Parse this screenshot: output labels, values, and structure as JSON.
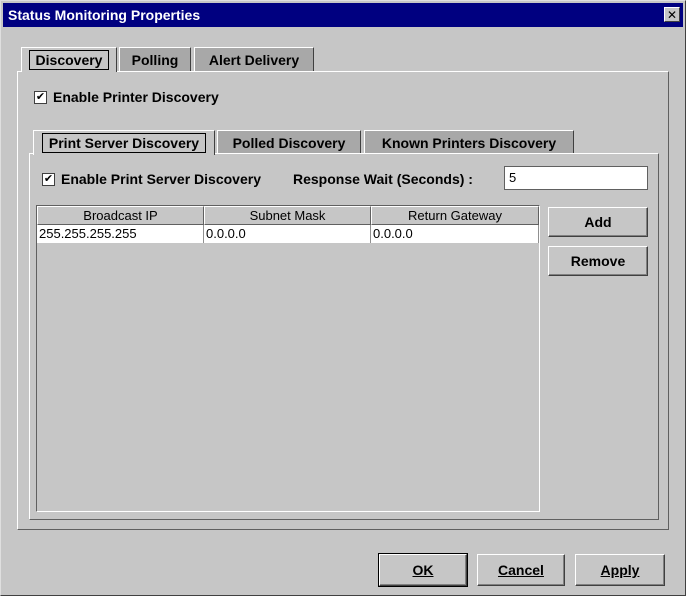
{
  "window": {
    "title": "Status Monitoring Properties",
    "close_label": "✕"
  },
  "outer_tabs": [
    {
      "label": "Discovery",
      "selected": true
    },
    {
      "label": "Polling",
      "selected": false
    },
    {
      "label": "Alert Delivery",
      "selected": false
    }
  ],
  "discovery": {
    "enable_printer_discovery": {
      "label": "Enable Printer Discovery",
      "checked": true
    },
    "inner_tabs": [
      {
        "label": "Print Server Discovery",
        "selected": true
      },
      {
        "label": "Polled Discovery",
        "selected": false
      },
      {
        "label": "Known Printers Discovery",
        "selected": false
      }
    ],
    "print_server": {
      "enable": {
        "label": "Enable Print Server Discovery",
        "checked": true
      },
      "response_wait_label": "Response Wait (Seconds) :",
      "response_wait_value": "5",
      "table": {
        "columns": [
          "Broadcast IP",
          "Subnet Mask",
          "Return Gateway"
        ],
        "rows": [
          [
            "255.255.255.255",
            "0.0.0.0",
            "0.0.0.0"
          ]
        ]
      },
      "add_label": "Add",
      "remove_label": "Remove"
    }
  },
  "footer": {
    "ok_label": "OK",
    "cancel_label": "Cancel",
    "apply_label": "Apply"
  }
}
